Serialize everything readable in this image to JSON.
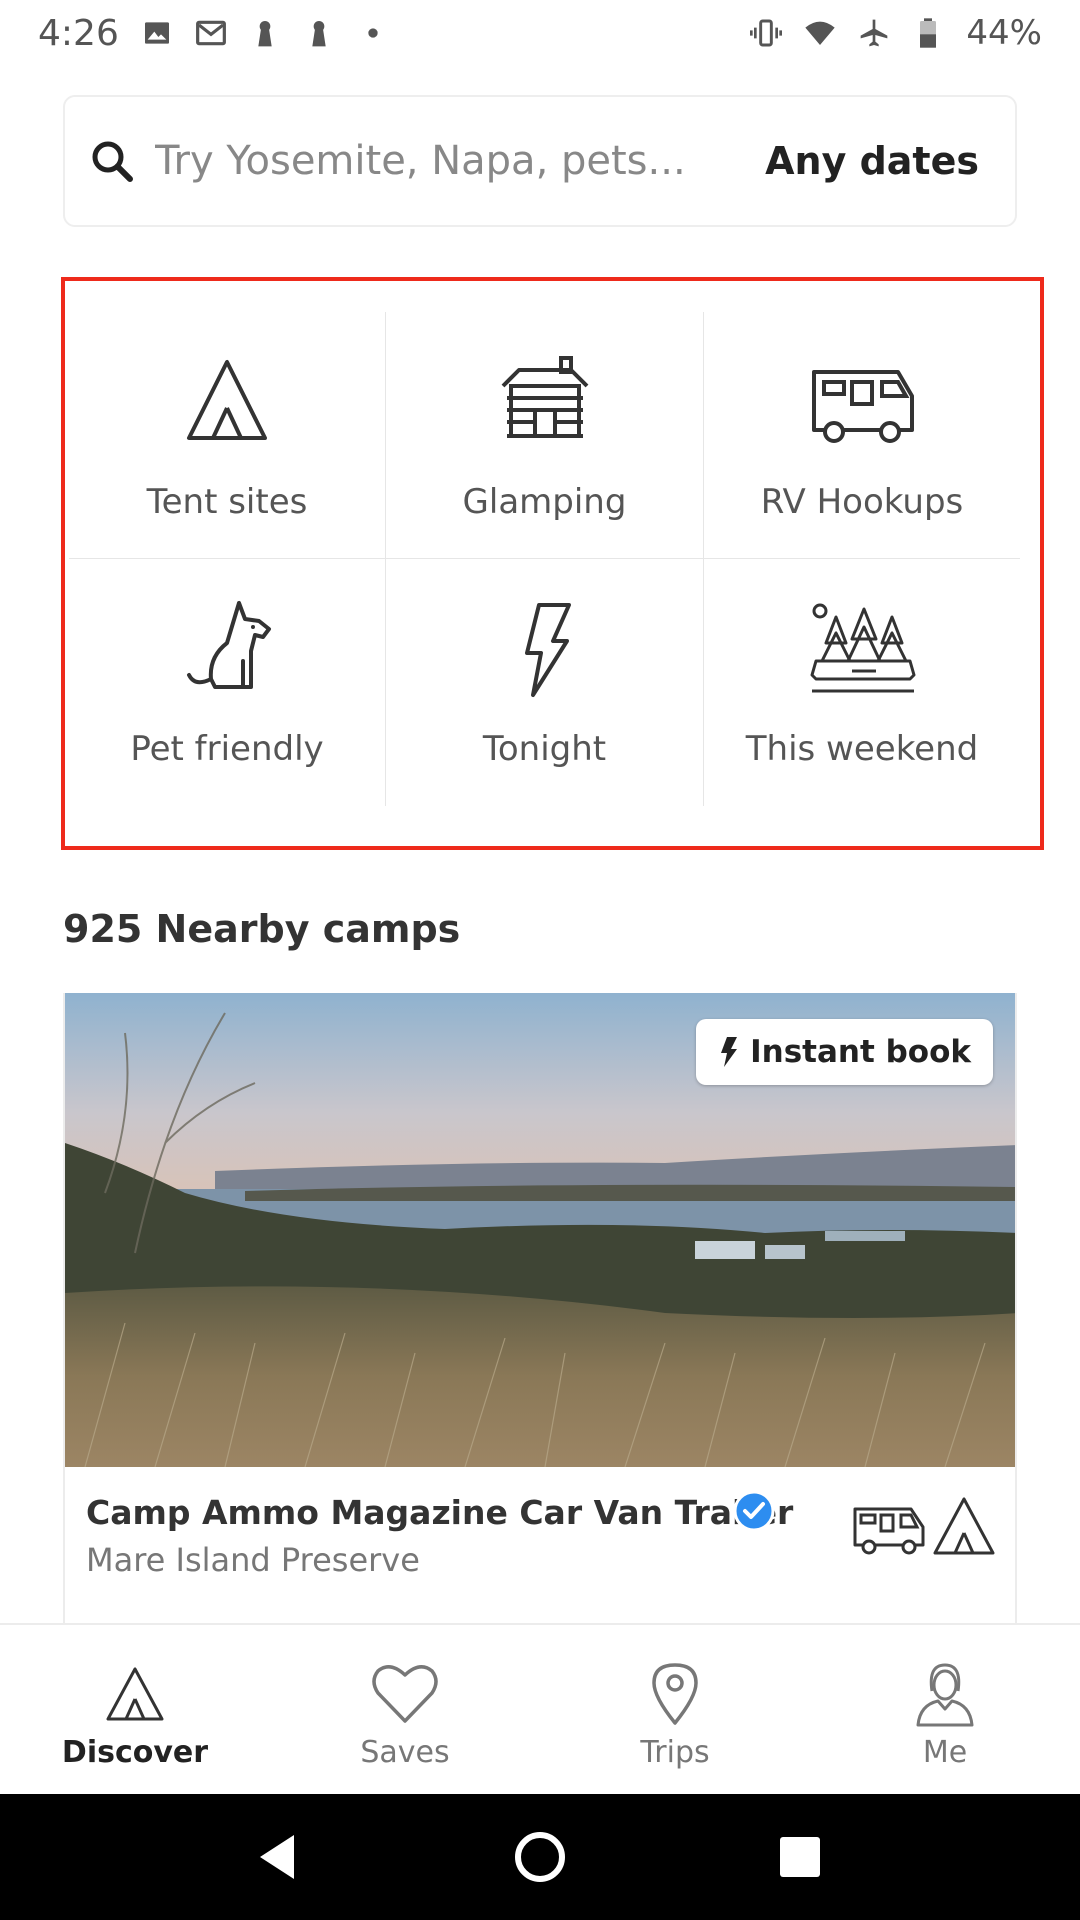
{
  "status_bar": {
    "time": "4:26",
    "battery": "44%",
    "icons": [
      "image-icon",
      "gmail-icon",
      "keyhole-icon",
      "keyhole-icon",
      "dot-icon",
      "vibrate-icon",
      "wifi-icon",
      "airplane-icon",
      "battery-icon"
    ]
  },
  "search": {
    "placeholder": "Try Yosemite, Napa, pets...",
    "dates_label": "Any dates"
  },
  "categories": [
    {
      "label": "Tent sites",
      "icon": "tent-icon"
    },
    {
      "label": "Glamping",
      "icon": "cabin-icon"
    },
    {
      "label": "RV Hookups",
      "icon": "rv-icon"
    },
    {
      "label": "Pet friendly",
      "icon": "dog-icon"
    },
    {
      "label": "Tonight",
      "icon": "lightning-icon"
    },
    {
      "label": "This weekend",
      "icon": "forest-icon"
    }
  ],
  "highlight_color": "#ee2a1b",
  "nearby": {
    "title": "925 Nearby camps"
  },
  "camp_card": {
    "badge": "Instant book",
    "name": "Camp Ammo Magazine Car Van Trailer",
    "location": "Mare Island Preserve",
    "verified_color": "#2d8df0",
    "type_icons": [
      "rv-icon",
      "tent-icon"
    ]
  },
  "bottom_nav": [
    {
      "label": "Discover",
      "icon": "tent-icon",
      "active": true
    },
    {
      "label": "Saves",
      "icon": "heart-icon",
      "active": false
    },
    {
      "label": "Trips",
      "icon": "map-pin-icon",
      "active": false
    },
    {
      "label": "Me",
      "icon": "profile-icon",
      "active": false
    }
  ],
  "system_nav": [
    "back-icon",
    "home-icon",
    "recents-icon"
  ]
}
